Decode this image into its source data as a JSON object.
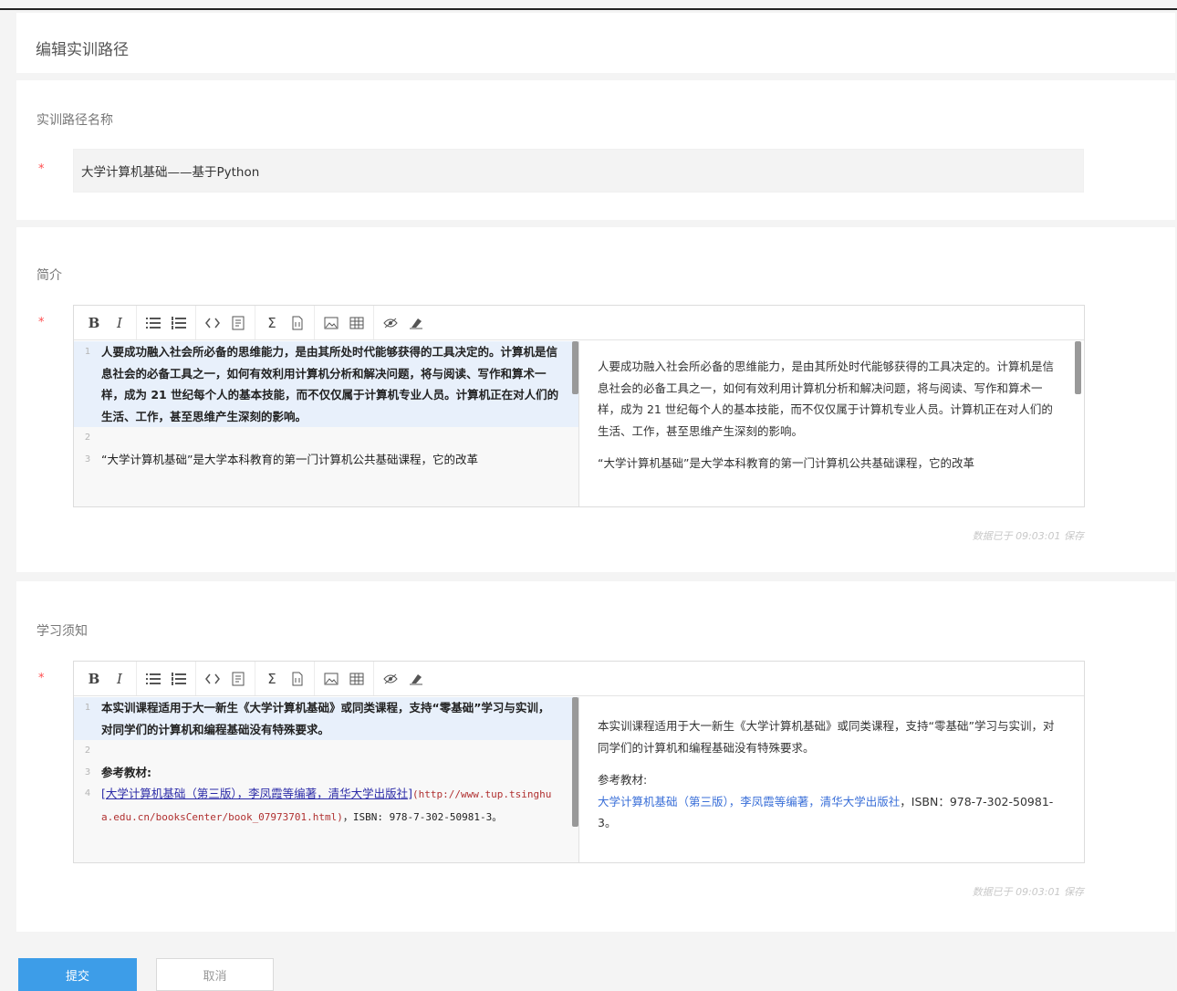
{
  "page": {
    "title": "编辑实训路径"
  },
  "name_section": {
    "label": "实训路径名称",
    "required_mark": "*",
    "value": "大学计算机基础——基于Python"
  },
  "intro_section": {
    "label": "简介",
    "required_mark": "*",
    "code_lines": [
      {
        "num": "1",
        "text": "人要成功融入社会所必备的思维能力，是由其所处时代能够获得的工具决定的。计算机是信息社会的必备工具之一，如何有效利用计算机分析和解决问题，将与阅读、写作和算术一样，成为 21 世纪每个人的基本技能，而不仅仅属于计算机专业人员。计算机正在对人们的生活、工作，甚至思维产生深刻的影响。"
      },
      {
        "num": "2",
        "text": ""
      },
      {
        "num": "3",
        "text": "“大学计算机基础”是大学本科教育的第一门计算机公共基础课程，它的改革"
      }
    ],
    "preview_paragraphs": [
      "人要成功融入社会所必备的思维能力，是由其所处时代能够获得的工具决定的。计算机是信息社会的必备工具之一，如何有效利用计算机分析和解决问题，将与阅读、写作和算术一样，成为 21 世纪每个人的基本技能，而不仅仅属于计算机专业人员。计算机正在对人们的生活、工作，甚至思维产生深刻的影响。",
      "“大学计算机基础”是大学本科教育的第一门计算机公共基础课程，它的改革"
    ],
    "saved_text": "数据已于 09:03:01 保存"
  },
  "notice_section": {
    "label": "学习须知",
    "required_mark": "*",
    "code_lines": [
      {
        "num": "1",
        "text": "本实训课程适用于大一新生《大学计算机基础》或同类课程，支持“零基础”学习与实训，对同学们的计算机和编程基础没有特殊要求。"
      },
      {
        "num": "2",
        "text": ""
      },
      {
        "num": "3",
        "text": "参考教材:"
      },
      {
        "num": "4",
        "link": "[大学计算机基础（第三版），李凤霞等编著，清华大学出版社]",
        "url": "(http://www.tup.tsinghua.edu.cn/booksCenter/book_07973701.html)",
        "tail": "，ISBN: 978-7-302-50981-3。"
      }
    ],
    "preview_para1": "本实训课程适用于大一新生《大学计算机基础》或同类课程，支持“零基础”学习与实训，对同学们的计算机和编程基础没有特殊要求。",
    "preview_ref_label": "参考教材:",
    "preview_ref_link": "大学计算机基础（第三版），李凤霞等编著，清华大学出版社",
    "preview_ref_tail": "，ISBN：978-7-302-50981-3。",
    "saved_text": "数据已于 09:03:01 保存"
  },
  "toolbar": {
    "bold": "B",
    "italic": "I",
    "sigma": "Σ"
  },
  "buttons": {
    "submit": "提交",
    "cancel": "取消"
  },
  "colors": {
    "primary": "#3d9de8",
    "required": "#ff4d4f",
    "link": "#3a6fd8"
  }
}
